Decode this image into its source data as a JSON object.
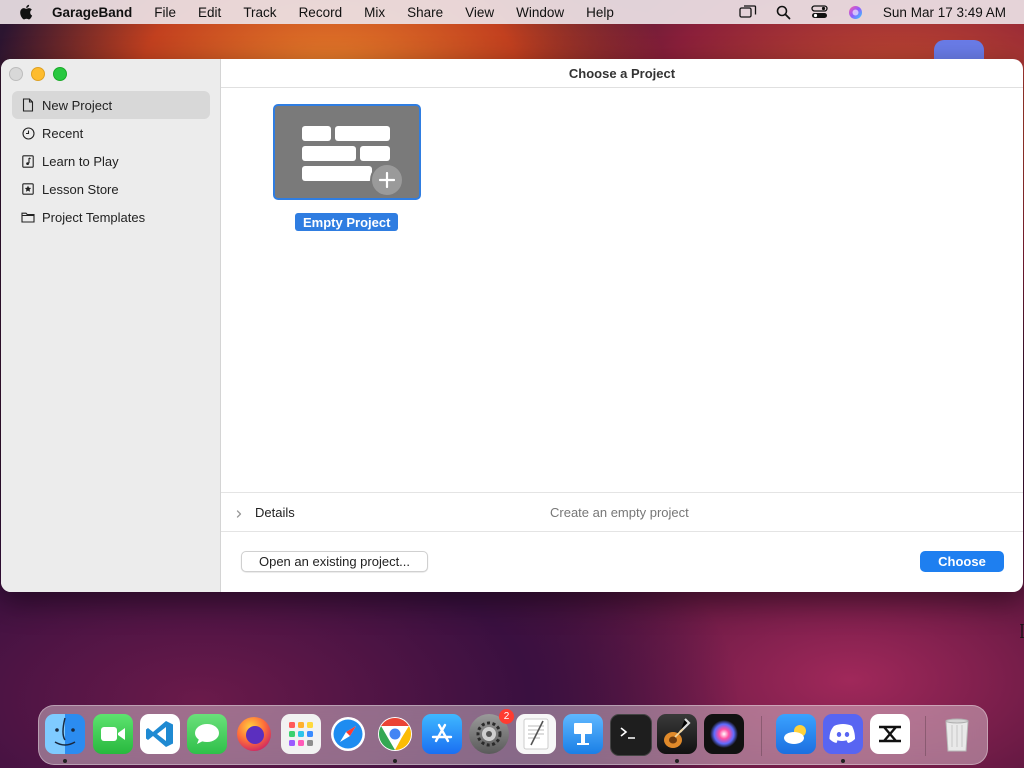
{
  "menubar": {
    "app_name": "GarageBand",
    "items": [
      "File",
      "Edit",
      "Track",
      "Record",
      "Mix",
      "Share",
      "View",
      "Window",
      "Help"
    ],
    "clock": "Sun Mar 17  3:49 AM"
  },
  "window": {
    "title": "Choose a Project",
    "sidebar": {
      "items": [
        {
          "label": "New Project",
          "icon": "document-icon",
          "selected": true
        },
        {
          "label": "Recent",
          "icon": "clock-icon"
        },
        {
          "label": "Learn to Play",
          "icon": "music-note-icon"
        },
        {
          "label": "Lesson Store",
          "icon": "star-icon"
        },
        {
          "label": "Project Templates",
          "icon": "folder-icon"
        }
      ]
    },
    "project": {
      "label": "Empty Project"
    },
    "details": {
      "label": "Details",
      "description": "Create an empty project"
    },
    "buttons": {
      "open": "Open an existing project...",
      "choose": "Choose"
    }
  },
  "dock": {
    "apps": [
      "Finder",
      "FaceTime",
      "Visual Studio Code",
      "Messages",
      "Firefox",
      "Launchpad",
      "Safari",
      "Google Chrome",
      "App Store",
      "System Settings",
      "TextEdit",
      "Keynote",
      "Terminal",
      "GarageBand",
      "Siri",
      "Weather",
      "Discord",
      "CapCut",
      "Trash"
    ],
    "system_settings_badge": "2"
  },
  "colors": {
    "accent": "#2f7de1",
    "choose_button": "#1e7ff0"
  }
}
